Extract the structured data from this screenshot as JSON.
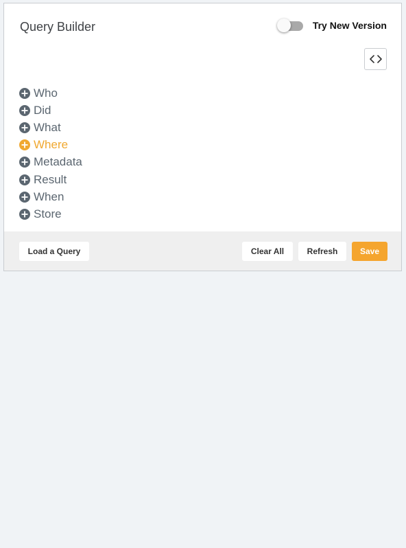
{
  "header": {
    "title": "Query Builder",
    "toggle_label": "Try New Version",
    "toggle_on": false,
    "code_button_icon": "code-brackets-icon"
  },
  "query_sections": [
    {
      "label": "Who",
      "icon": "plus-circle-icon",
      "active": false
    },
    {
      "label": "Did",
      "icon": "plus-circle-icon",
      "active": false
    },
    {
      "label": "What",
      "icon": "plus-circle-icon",
      "active": false
    },
    {
      "label": "Where",
      "icon": "plus-circle-icon",
      "active": true
    },
    {
      "label": "Metadata",
      "icon": "plus-circle-icon",
      "active": false
    },
    {
      "label": "Result",
      "icon": "plus-circle-icon",
      "active": false
    },
    {
      "label": "When",
      "icon": "plus-circle-icon",
      "active": false
    },
    {
      "label": "Store",
      "icon": "plus-circle-icon",
      "active": false
    }
  ],
  "footer": {
    "load_label": "Load a Query",
    "clear_label": "Clear All",
    "refresh_label": "Refresh",
    "save_label": "Save"
  },
  "colors": {
    "accent": "#f5a52e",
    "active_item": "#f0a830",
    "item_text": "#5b6670",
    "icon_fill": "#5b6670",
    "page_background": "#f0f3f6",
    "footer_background": "#efefef"
  }
}
